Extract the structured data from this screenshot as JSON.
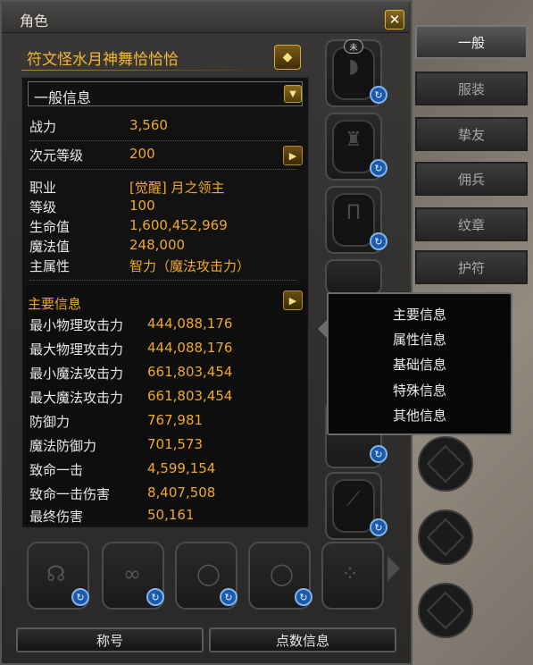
{
  "window": {
    "title": "角色",
    "close_glyph": "✕"
  },
  "character": {
    "name": "符文怪水月神舞恰恰恰"
  },
  "dropdown": {
    "selected": "一般信息"
  },
  "basic": [
    {
      "label": "战力",
      "value": "3,560"
    },
    {
      "label": "次元等级",
      "value": "200"
    }
  ],
  "profile": [
    {
      "label": "职业",
      "value": "[觉醒] 月之领主"
    },
    {
      "label": "等级",
      "value": "100"
    },
    {
      "label": "生命值",
      "value": "1,600,452,969"
    },
    {
      "label": "魔法值",
      "value": "248,000"
    },
    {
      "label": "主属性",
      "value": "智力（魔法攻击力）"
    }
  ],
  "main_info": {
    "title": "主要信息",
    "stats": [
      {
        "label": "最小物理攻击力",
        "value": "444,088,176"
      },
      {
        "label": "最大物理攻击力",
        "value": "444,088,176"
      },
      {
        "label": "最小魔法攻击力",
        "value": "661,803,454"
      },
      {
        "label": "最大魔法攻击力",
        "value": "661,803,454"
      },
      {
        "label": "防御力",
        "value": "767,981"
      },
      {
        "label": "魔法防御力",
        "value": "701,573"
      },
      {
        "label": "致命一击",
        "value": "4,599,154"
      },
      {
        "label": "致命一击伤害",
        "value": "8,407,508"
      },
      {
        "label": "最终伤害",
        "value": "50,161"
      }
    ]
  },
  "popup_menu": [
    "主要信息",
    "属性信息",
    "基础信息",
    "特殊信息",
    "其他信息"
  ],
  "tabs": [
    {
      "label": "一般",
      "active": true
    },
    {
      "label": "服装",
      "active": false
    },
    {
      "label": "挚友",
      "active": false
    },
    {
      "label": "佣兵",
      "active": false
    },
    {
      "label": "纹章",
      "active": false
    },
    {
      "label": "护符",
      "active": false
    }
  ],
  "bottom_buttons": {
    "title_label": "称号",
    "points_label": "点数信息"
  },
  "slot_badge": "未",
  "icons": {
    "refresh": "refresh-icon",
    "expand": "chevron-right-icon",
    "dropdown": "chevron-down-icon",
    "name_action": "diamond-arrow-icon",
    "close": "close-icon"
  },
  "colors": {
    "accent": "#f0a82c",
    "name": "#f5b632",
    "text": "#e8e8e8"
  }
}
